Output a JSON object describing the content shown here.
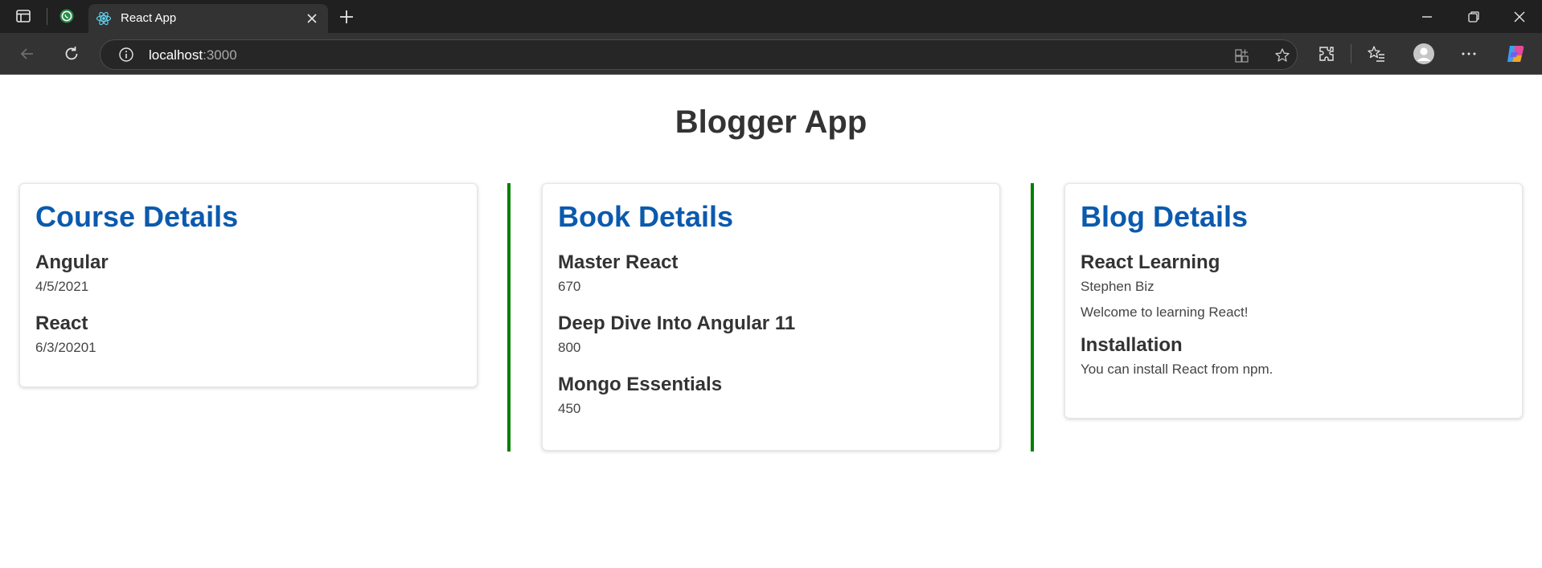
{
  "browser": {
    "tab_title": "React App",
    "url_host": "localhost",
    "url_port": ":3000",
    "icons": [
      "sidebar-icon",
      "whatsapp-icon",
      "react-icon",
      "close-icon",
      "plus-icon",
      "minimize-icon",
      "restore-icon",
      "close-window-icon",
      "back-icon",
      "refresh-icon",
      "info-icon",
      "app-available-icon",
      "favorite-star-icon",
      "extensions-icon",
      "favorites-icon",
      "profile-icon",
      "more-icon",
      "copilot-icon"
    ]
  },
  "page": {
    "title": "Blogger App",
    "course": {
      "heading": "Course Details",
      "items": [
        {
          "name": "Angular",
          "date": "4/5/2021"
        },
        {
          "name": "React",
          "date": "6/3/20201"
        }
      ]
    },
    "book": {
      "heading": "Book Details",
      "items": [
        {
          "name": "Master React",
          "price": "670"
        },
        {
          "name": "Deep Dive Into Angular 11",
          "price": "800"
        },
        {
          "name": "Mongo Essentials",
          "price": "450"
        }
      ]
    },
    "blog": {
      "heading": "Blog Details",
      "items": [
        {
          "title": "React Learning",
          "author": "Stephen Biz",
          "text": "Welcome to learning React!"
        },
        {
          "title": "Installation",
          "text": "You can install React from npm."
        }
      ]
    }
  },
  "colors": {
    "heading_blue": "#0b5aad",
    "divider_green": "#008000",
    "chrome_dark": "#202020"
  }
}
